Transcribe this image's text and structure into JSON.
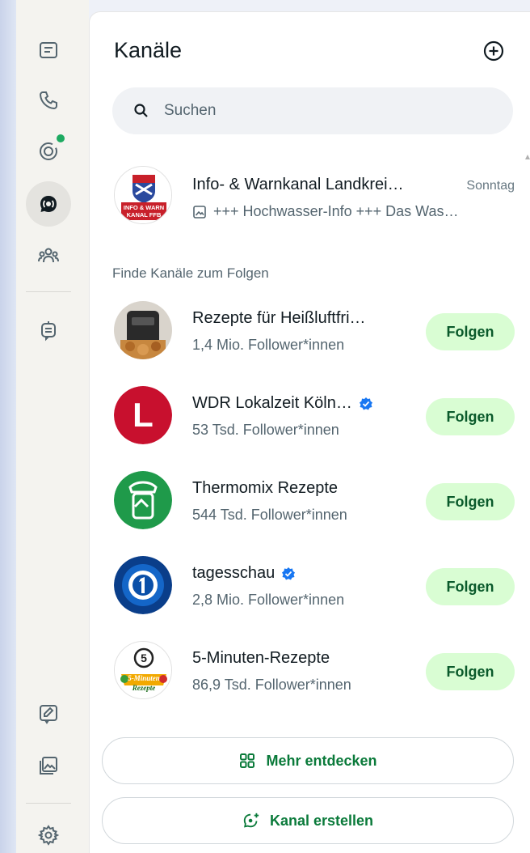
{
  "panel": {
    "title": "Kanäle"
  },
  "search": {
    "placeholder": "Suchen"
  },
  "followed_channels": [
    {
      "name": "Info- & Warnkanal Landkrei…",
      "time": "Sonntag",
      "preview": "+++ Hochwasser-Info +++ Das Was…",
      "avatar_text_1": "INFO & WARN",
      "avatar_text_2": "KANAL FFB"
    }
  ],
  "suggestions_heading": "Finde Kanäle zum Folgen",
  "suggestions": [
    {
      "name": "Rezepte für Heißluftfri…",
      "followers": "1,4 Mio. Follower*innen",
      "verified": false,
      "button": "Folgen"
    },
    {
      "name": "WDR Lokalzeit Köln…",
      "followers": "53 Tsd. Follower*innen",
      "verified": true,
      "button": "Folgen",
      "avatar_letter": "L"
    },
    {
      "name": "Thermomix Rezepte",
      "followers": "544 Tsd. Follower*innen",
      "verified": false,
      "button": "Folgen"
    },
    {
      "name": "tagesschau",
      "followers": "2,8 Mio. Follower*innen",
      "verified": true,
      "button": "Folgen"
    },
    {
      "name": "5-Minuten-Rezepte",
      "followers": "86,9 Tsd. Follower*innen",
      "verified": false,
      "button": "Folgen",
      "avatar_text_1": "5",
      "avatar_text_2": "5-Minuten",
      "avatar_text_3": "Rezepte"
    }
  ],
  "actions": {
    "discover": "Mehr entdecken",
    "create": "Kanal erstellen"
  },
  "colors": {
    "accent_green": "#1daa61",
    "follow_bg": "#d9fdd3",
    "verified_blue": "#1877f2"
  }
}
